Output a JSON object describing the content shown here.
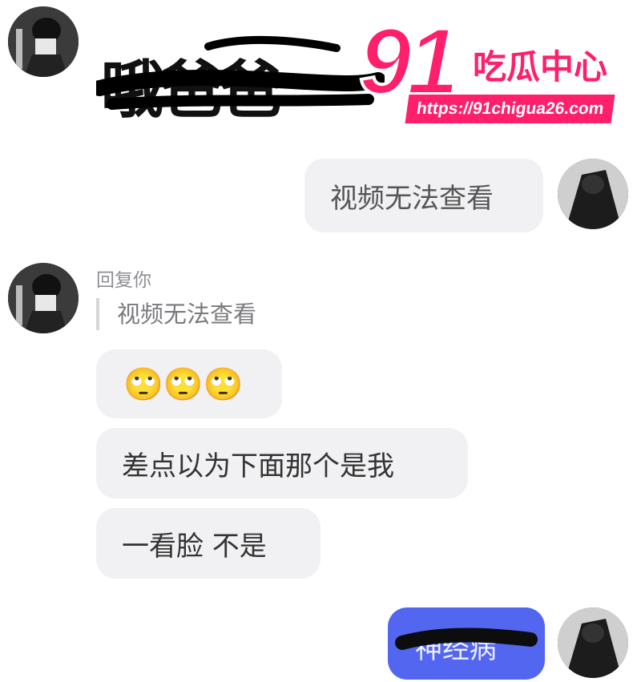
{
  "header": {
    "contact_name": "哦爸爸"
  },
  "watermark": {
    "number": "91",
    "label": "吃瓜中心",
    "url": "https://91chigua26.com"
  },
  "messages": [
    {
      "side": "right",
      "text": "视频无法查看"
    },
    {
      "side": "left",
      "reply_label": "回复你",
      "quoted_text": "视频无法查看",
      "text": "🙄🙄🙄"
    },
    {
      "side": "left",
      "text": "差点以为下面那个是我"
    },
    {
      "side": "left",
      "text": "一看脸 不是"
    },
    {
      "side": "right",
      "text": "神经病"
    }
  ],
  "colors": {
    "bubble_received": "#f1f1f3",
    "bubble_sent_blue": "#5266f0",
    "watermark_pink": "#ff1f6b"
  }
}
